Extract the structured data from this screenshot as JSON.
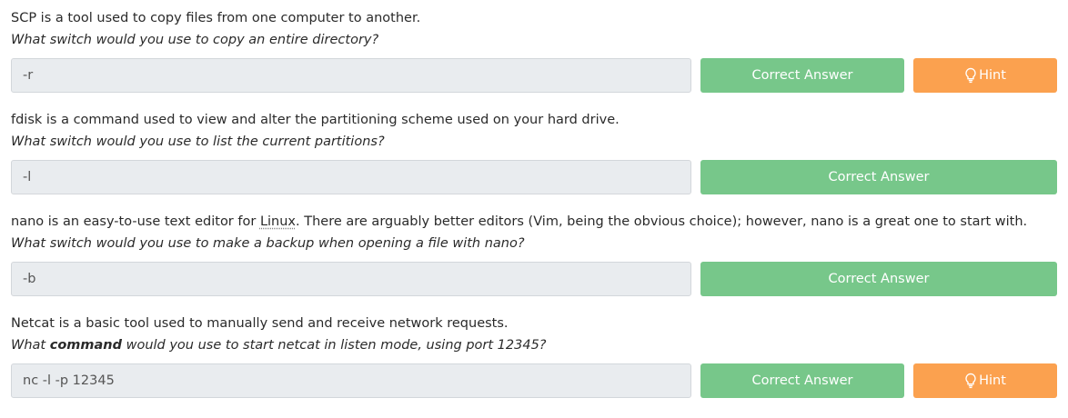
{
  "questions": [
    {
      "text": "SCP is a tool used to copy files from one computer to another.",
      "prompt": "What switch would you use to copy an entire directory?",
      "answer": "-r",
      "correct_label": "Correct Answer",
      "hint_label": "Hint"
    },
    {
      "text": "fdisk is a command used to view and alter the partitioning scheme used on your hard drive.",
      "prompt": "What switch would you use to list the current partitions?",
      "answer": "-l",
      "correct_label": "Correct Answer"
    },
    {
      "text_before": "nano is an easy-to-use text editor for ",
      "text_abbr": "Linux",
      "text_after": ". There are arguably better editors (Vim, being the obvious choice); however, nano is a great one to start with.",
      "prompt": "What switch would you use to make a backup when opening a file with nano?",
      "answer": "-b",
      "correct_label": "Correct Answer"
    },
    {
      "text": "Netcat is a basic tool used to manually send and receive network requests.",
      "prompt_before": "What ",
      "prompt_bold": "command",
      "prompt_after": " would you use to start netcat in listen mode, using port 12345?",
      "answer": "nc -l -p 12345",
      "correct_label": "Correct Answer",
      "hint_label": "Hint"
    }
  ],
  "icons": {
    "hint": "lightbulb-icon"
  },
  "colors": {
    "correct": "#77c78a",
    "hint": "#fba14f",
    "input_bg": "#e9ecef"
  }
}
